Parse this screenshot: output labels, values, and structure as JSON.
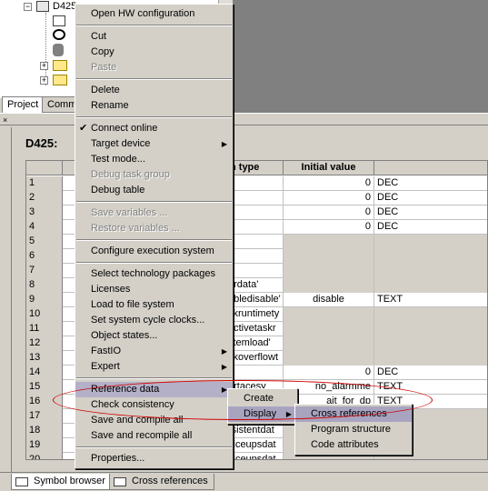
{
  "tree": {
    "node_label": "D425",
    "tab_project": "Project",
    "tab_comm": "Comm"
  },
  "panel": {
    "title": "D425:",
    "headers": {
      "type": "n type",
      "initial": "Initial value"
    }
  },
  "rows": [
    {
      "n": "1",
      "type": "",
      "init": "0",
      "fmt": "DEC"
    },
    {
      "n": "2",
      "type": "",
      "init": "0",
      "fmt": "DEC"
    },
    {
      "n": "3",
      "type": "",
      "init": "0",
      "fmt": "DEC"
    },
    {
      "n": "4",
      "type": "",
      "init": "0",
      "fmt": "DEC"
    },
    {
      "n": "5",
      "type": "",
      "init": "",
      "fmt": ""
    },
    {
      "n": "6",
      "type": "",
      "init": "",
      "fmt": ""
    },
    {
      "n": "7",
      "type": "",
      "init": "",
      "fmt": ""
    },
    {
      "n": "8",
      "type": "erdata'",
      "init": "",
      "fmt": ""
    },
    {
      "n": "9",
      "type": "abledisable'",
      "init": "disable",
      "fmt": "TEXT"
    },
    {
      "n": "10",
      "type": "skruntimety",
      "init": "",
      "fmt": ""
    },
    {
      "n": "11",
      "type": "ectivetaskr",
      "init": "",
      "fmt": ""
    },
    {
      "n": "12",
      "type": "stemload'",
      "init": "",
      "fmt": ""
    },
    {
      "n": "13",
      "type": "skoverflowt",
      "init": "",
      "fmt": ""
    },
    {
      "n": "14",
      "type": "",
      "init": "0",
      "fmt": "DEC"
    },
    {
      "n": "15",
      "type": "ertacesy",
      "init": "no_alarmme",
      "fmt": "TEXT"
    },
    {
      "n": "16",
      "type": "",
      "init": "ait_for_dp",
      "fmt": "TEXT"
    },
    {
      "n": "17",
      "type": "",
      "init": "",
      "fmt": ""
    },
    {
      "n": "18",
      "type": "rsistentdat",
      "init": "",
      "fmt": ""
    },
    {
      "n": "19",
      "type": "viceupsdat",
      "init": "",
      "fmt": ""
    },
    {
      "n": "20",
      "type": "viceupsdat",
      "init": "",
      "fmt": ""
    }
  ],
  "bottom_tabs": [
    "Symbol browser",
    "Cross references"
  ],
  "context_menu": [
    {
      "label": "Open HW configuration"
    },
    {
      "sep": true
    },
    {
      "label": "Cut"
    },
    {
      "label": "Copy"
    },
    {
      "label": "Paste",
      "disabled": true
    },
    {
      "sep": true
    },
    {
      "label": "Delete"
    },
    {
      "label": "Rename"
    },
    {
      "sep": true
    },
    {
      "label": "Connect online",
      "checked": true
    },
    {
      "label": "Target device",
      "submenu": true
    },
    {
      "label": "Test mode..."
    },
    {
      "label": "Debug task group",
      "disabled": true
    },
    {
      "label": "Debug table"
    },
    {
      "sep": true
    },
    {
      "label": "Save variables ...",
      "disabled": true
    },
    {
      "label": "Restore variables ...",
      "disabled": true
    },
    {
      "sep": true
    },
    {
      "label": "Configure execution system"
    },
    {
      "sep": true
    },
    {
      "label": "Select technology packages"
    },
    {
      "label": "Licenses"
    },
    {
      "label": "Load to file system"
    },
    {
      "label": "Set system cycle clocks..."
    },
    {
      "label": "Object states..."
    },
    {
      "label": "FastIO",
      "submenu": true
    },
    {
      "label": "Expert",
      "submenu": true
    },
    {
      "sep": true
    },
    {
      "label": "Reference data",
      "submenu": true,
      "highlight": true
    },
    {
      "label": "Check consistency"
    },
    {
      "label": "Save and compile all"
    },
    {
      "label": "Save and recompile all"
    },
    {
      "sep": true
    },
    {
      "label": "Properties..."
    }
  ],
  "submenu1": [
    {
      "label": "Create"
    },
    {
      "label": "Display",
      "submenu": true,
      "highlight": true
    }
  ],
  "submenu2": [
    {
      "label": "Cross references",
      "highlight": true
    },
    {
      "label": "Program structure"
    },
    {
      "label": "Code attributes"
    }
  ],
  "colors": {
    "menu_bg": "#d4d0c8",
    "highlight": "#b4b0c8",
    "annotation": "#d00000"
  }
}
